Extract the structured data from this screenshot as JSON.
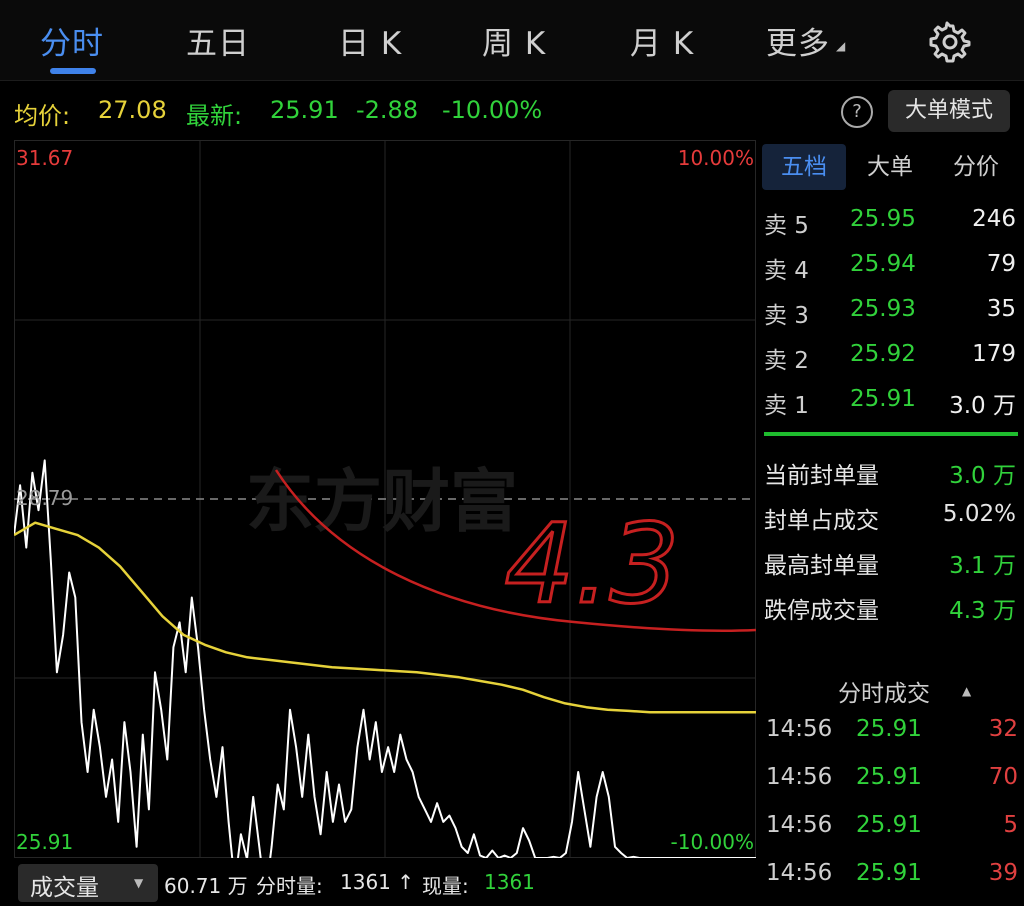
{
  "tabs": [
    {
      "label": "分时",
      "active": true
    },
    {
      "label": "五日",
      "active": false
    },
    {
      "label": "日 K",
      "active": false
    },
    {
      "label": "周 K",
      "active": false
    },
    {
      "label": "月 K",
      "active": false
    },
    {
      "label": "更多",
      "active": false
    }
  ],
  "more_caret": "◢",
  "settings_icon": "gear-icon",
  "info": {
    "avg_label": "均价:",
    "avg_value": "27.08",
    "latest_label": "最新:",
    "latest_value": "25.91",
    "change": "-2.88",
    "change_pct": "-10.00%",
    "help_symbol": "?",
    "big_order_button": "大单模式"
  },
  "chart": {
    "top_price": "31.67",
    "top_pct": "10.00%",
    "mid_price": "28.79",
    "bottom_price": "25.91",
    "bottom_pct": "-10.00%",
    "watermark": "东方财富",
    "handwriting": "4.3",
    "colors": {
      "up": "#e63b3b",
      "down": "#31d23b",
      "avg": "#e6d23a",
      "price": "#ffffff"
    }
  },
  "chart_data": {
    "type": "line",
    "ylim": [
      25.91,
      31.67
    ],
    "prev_close": 28.79,
    "series": [
      {
        "values": [
          28.5,
          28.9,
          28.4,
          29.0,
          28.7,
          29.1,
          28.3,
          27.4,
          27.7,
          28.2,
          28.0,
          27.0,
          26.6,
          27.1,
          26.8,
          26.4,
          26.7,
          26.2,
          27.0,
          26.6,
          26.0,
          26.9,
          26.3,
          27.4,
          27.1,
          26.7,
          27.6,
          27.8,
          27.4,
          28.0,
          27.6,
          27.1,
          26.7,
          26.4,
          26.8,
          26.2,
          25.7,
          26.1,
          25.9,
          26.4,
          26.0,
          25.6,
          26.0,
          26.5,
          26.3,
          27.1,
          26.8,
          26.4,
          26.9,
          26.4,
          26.1,
          26.6,
          26.2,
          26.5,
          26.2,
          26.3,
          26.8,
          27.1,
          26.7,
          27.0,
          26.6,
          26.8,
          26.6,
          26.9,
          26.7,
          26.6,
          26.4,
          26.3,
          26.2,
          26.35,
          26.2,
          26.25,
          26.15,
          26.0,
          25.95,
          26.1,
          25.93,
          25.91,
          25.97,
          25.91,
          25.93,
          25.91,
          25.95,
          26.15,
          26.05,
          25.91,
          25.91,
          25.91,
          25.92,
          25.91,
          25.95,
          26.2,
          26.6,
          26.3,
          26.0,
          26.4,
          26.6,
          26.4,
          26.0,
          25.95,
          25.91,
          25.92,
          25.91,
          25.91,
          25.91,
          25.91,
          25.91,
          25.91,
          25.91,
          25.91,
          25.91,
          25.91,
          25.91,
          25.91,
          25.91,
          25.91,
          25.91,
          25.91,
          25.91,
          25.91,
          25.91,
          25.91
        ]
      },
      {
        "values": [
          28.5,
          28.6,
          28.55,
          28.5,
          28.4,
          28.25,
          28.05,
          27.85,
          27.7,
          27.62,
          27.56,
          27.52,
          27.5,
          27.48,
          27.46,
          27.44,
          27.43,
          27.42,
          27.41,
          27.4,
          27.38,
          27.36,
          27.33,
          27.3,
          27.26,
          27.2,
          27.15,
          27.12,
          27.1,
          27.09,
          27.08,
          27.08,
          27.08,
          27.08,
          27.08,
          27.08
        ]
      }
    ]
  },
  "sidebar": {
    "tabs": [
      {
        "label": "五档",
        "active": true
      },
      {
        "label": "大单",
        "active": false
      },
      {
        "label": "分价",
        "active": false
      }
    ],
    "orderbook": [
      {
        "label": "卖 5",
        "price": "25.95",
        "volume": "246"
      },
      {
        "label": "卖 4",
        "price": "25.94",
        "volume": "79"
      },
      {
        "label": "卖 3",
        "price": "25.93",
        "volume": "35"
      },
      {
        "label": "卖 2",
        "price": "25.92",
        "volume": "179"
      },
      {
        "label": "卖 1",
        "price": "25.91",
        "volume": "3.0 万"
      }
    ],
    "stats": [
      {
        "label": "当前封单量",
        "value": "3.0 万",
        "color": "#31d23b"
      },
      {
        "label": "封单占成交",
        "value": "5.02%",
        "color": "#e6e6e6"
      },
      {
        "label": "最高封单量",
        "value": "3.1 万",
        "color": "#31d23b"
      },
      {
        "label": "跌停成交量",
        "value": "4.3 万",
        "color": "#31d23b"
      }
    ],
    "trades_title": "分时成交",
    "trades_caret": "▲",
    "trades": [
      {
        "time": "14:56",
        "price": "25.91",
        "volume": "32"
      },
      {
        "time": "14:56",
        "price": "25.91",
        "volume": "70"
      },
      {
        "time": "14:56",
        "price": "25.91",
        "volume": "5"
      },
      {
        "time": "14:56",
        "price": "25.91",
        "volume": "39"
      }
    ]
  },
  "bottom": {
    "volume_selector": "成交量",
    "volume_caret": "▼",
    "total": "60.71 万",
    "minute_label": "分时量:",
    "minute_value": "1361 ↑",
    "current_label": "现量:",
    "current_value": "1361"
  }
}
